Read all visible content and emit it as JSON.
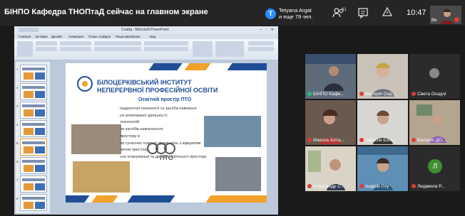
{
  "meeting": {
    "title": "БІНПО Кафедра ТНОПтаД сейчас на главном экране",
    "notification_name": "Tetyana Argat",
    "notification_text": "и еще 79 чел.",
    "notification_initial": "T",
    "participants_count": "81",
    "clock": "10:47",
    "self_label": "Ви"
  },
  "powerpoint": {
    "window_title": "Слайд - Microsoft PowerPoint",
    "tabs": [
      "Главная",
      "Вставка",
      "Дизайн",
      "Анимация",
      "Показ слайдов",
      "Рецензирование",
      "Вид"
    ],
    "slide_numbers": [
      "1",
      "2",
      "3",
      "4",
      "5",
      "6",
      "7",
      "8"
    ]
  },
  "slide": {
    "org_line1": "БІЛОЦЕРКІВСЬКИЙ ІНСТИТУТ",
    "org_line2": "НЕПЕРЕРВНОЇ ПРОФЕСІЙНОЇ ОСВІТИ",
    "subtitle": "Освітній простір ПТО",
    "bullets": [
      "педагогічні технології та засоби навчання",
      "ня аплікованої діяльності;",
      "технологій",
      "ня засобів навчального",
      "простору в",
      "ня сучасних освітніх приміщень з відкритим",
      "чатом простору;",
      "сне планування та дизайн освітнього простору"
    ],
    "pto_text": "ПТО"
  },
  "participants": [
    {
      "name": "БІНПО Кафе...",
      "mic": "on"
    },
    {
      "name": "Вікторія Сид...",
      "mic": "off"
    },
    {
      "name": "Света Осадчі",
      "mic": "off"
    },
    {
      "name": "Инесса Алта...",
      "mic": "off"
    },
    {
      "name": "Наталія Бого...",
      "mic": "off"
    },
    {
      "name": "Валерія ДО...",
      "mic": "off"
    },
    {
      "name": "Александр С...",
      "mic": "off"
    },
    {
      "name": "Андрій Пту",
      "mic": "off"
    },
    {
      "name": "Людмила Р...",
      "mic": "off",
      "initial": "Л"
    }
  ],
  "colors": {
    "accent_blue": "#1f4e96",
    "accent_orange": "#f2a12a",
    "mic_off": "#e03b3b",
    "zoom_blue": "#2d8cff"
  },
  "icons": [
    "participants-icon",
    "chat-icon",
    "share-icon",
    "mic-off-icon"
  ]
}
